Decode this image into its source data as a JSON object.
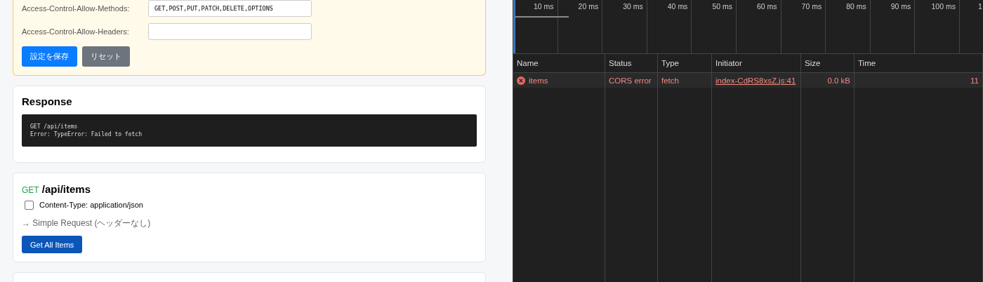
{
  "cors_settings": {
    "fields": [
      {
        "label": "Access-Control-Allow-Methods:",
        "value": "GET,POST,PUT,PATCH,DELETE,OPTIONS"
      },
      {
        "label": "Access-Control-Allow-Headers:"
      }
    ],
    "buttons": [
      {
        "label": "設定を保存",
        "kind": "primary"
      },
      {
        "label": "リセット",
        "kind": "secondary"
      }
    ]
  },
  "response": {
    "title": "Response",
    "lines": [
      "GET /api/items",
      "Error: TypeError: Failed to fetch"
    ]
  },
  "endpoint": {
    "method": "GET",
    "path": "/api/items",
    "option": {
      "label": "Content-Type: application/json",
      "checked": false
    },
    "note": "→ Simple Request (ヘッダーなし)",
    "button": "Get All Items"
  },
  "network": {
    "ticks": [
      "10 ms",
      "20 ms",
      "30 ms",
      "40 ms",
      "50 ms",
      "60 ms",
      "70 ms",
      "80 ms",
      "90 ms",
      "100 ms",
      "1"
    ],
    "columns": [
      "Name",
      "Status",
      "Type",
      "Initiator",
      "Size",
      "Time"
    ],
    "requests": [
      {
        "name": "items",
        "status": "CORS error",
        "type": "fetch",
        "initiator": "index-CdRS8xsZ.js:41",
        "size": "0.0 kB",
        "time": "11",
        "error": true
      }
    ]
  }
}
